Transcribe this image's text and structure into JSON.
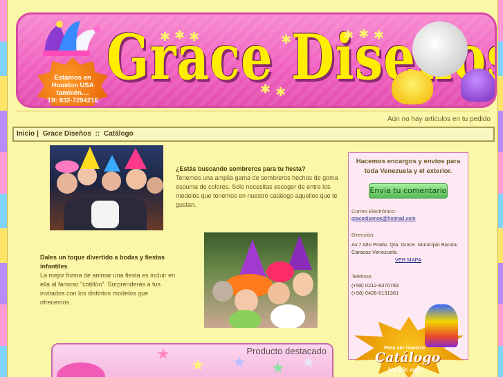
{
  "banner": {
    "logo": "Grace Diseños",
    "badge_line1": "Estamos en",
    "badge_line2": "Houston USA",
    "badge_line3": "también....",
    "badge_line4": "Tlf: 832-7294216"
  },
  "cart": {
    "status": "Aún no hay artículos en tu pedido"
  },
  "breadcrumb": {
    "home": "Inicio",
    "sep1": "|",
    "site": "Grace Diseños",
    "sep2": "::",
    "section": "Catálogo"
  },
  "block1": {
    "heading": "¿Estás buscando sombreros para tu fiesta?",
    "body": "Tenemos una amplia gama de sombreros hechos de goma espuma de colores. Solo necesitas escoger de entre los modelos que tenemos en nuestro catálogo aquellos que te gustan."
  },
  "block2": {
    "heading": "Dales un toque divertido a bodas y fiestas infantiles",
    "body": "La mejor forma de animar una fiesta es incluir en ella al famoso \"cotillón\". Sorprenderás a tus invitados con los distintos modelos que ofrecemos."
  },
  "info": {
    "intro": "Hacemos encargos y envíos para toda Venezuela y el exterior.",
    "comment_button": "Envia tu comentario",
    "email_label": "Correo Electrónico:",
    "email": "gracedisenos@hotmail.com",
    "address_label": "Dirección:",
    "address_line1": "Av.7 Alto Prado. Qta. Grace. Municipio Baruta.",
    "address_line2": "Caracas Venezuela.",
    "map_link": "VER MAPA",
    "phone_label": "Telefono:",
    "phone1": "(+58) 0212-8370783",
    "phone2": "(+58) 0426-6131361"
  },
  "catalog_promo": {
    "small": "Para ver nuestro",
    "big": "Catálogo",
    "click": "haz clic aquí"
  },
  "featured": {
    "title": "Producto destacado"
  },
  "colors": {
    "page_bg": "#fbf7a8",
    "banner_pink": "#f05fbf",
    "logo_yellow": "#ffee00",
    "button_green": "#6fd06a",
    "info_box_bg": "#fde9f3"
  }
}
